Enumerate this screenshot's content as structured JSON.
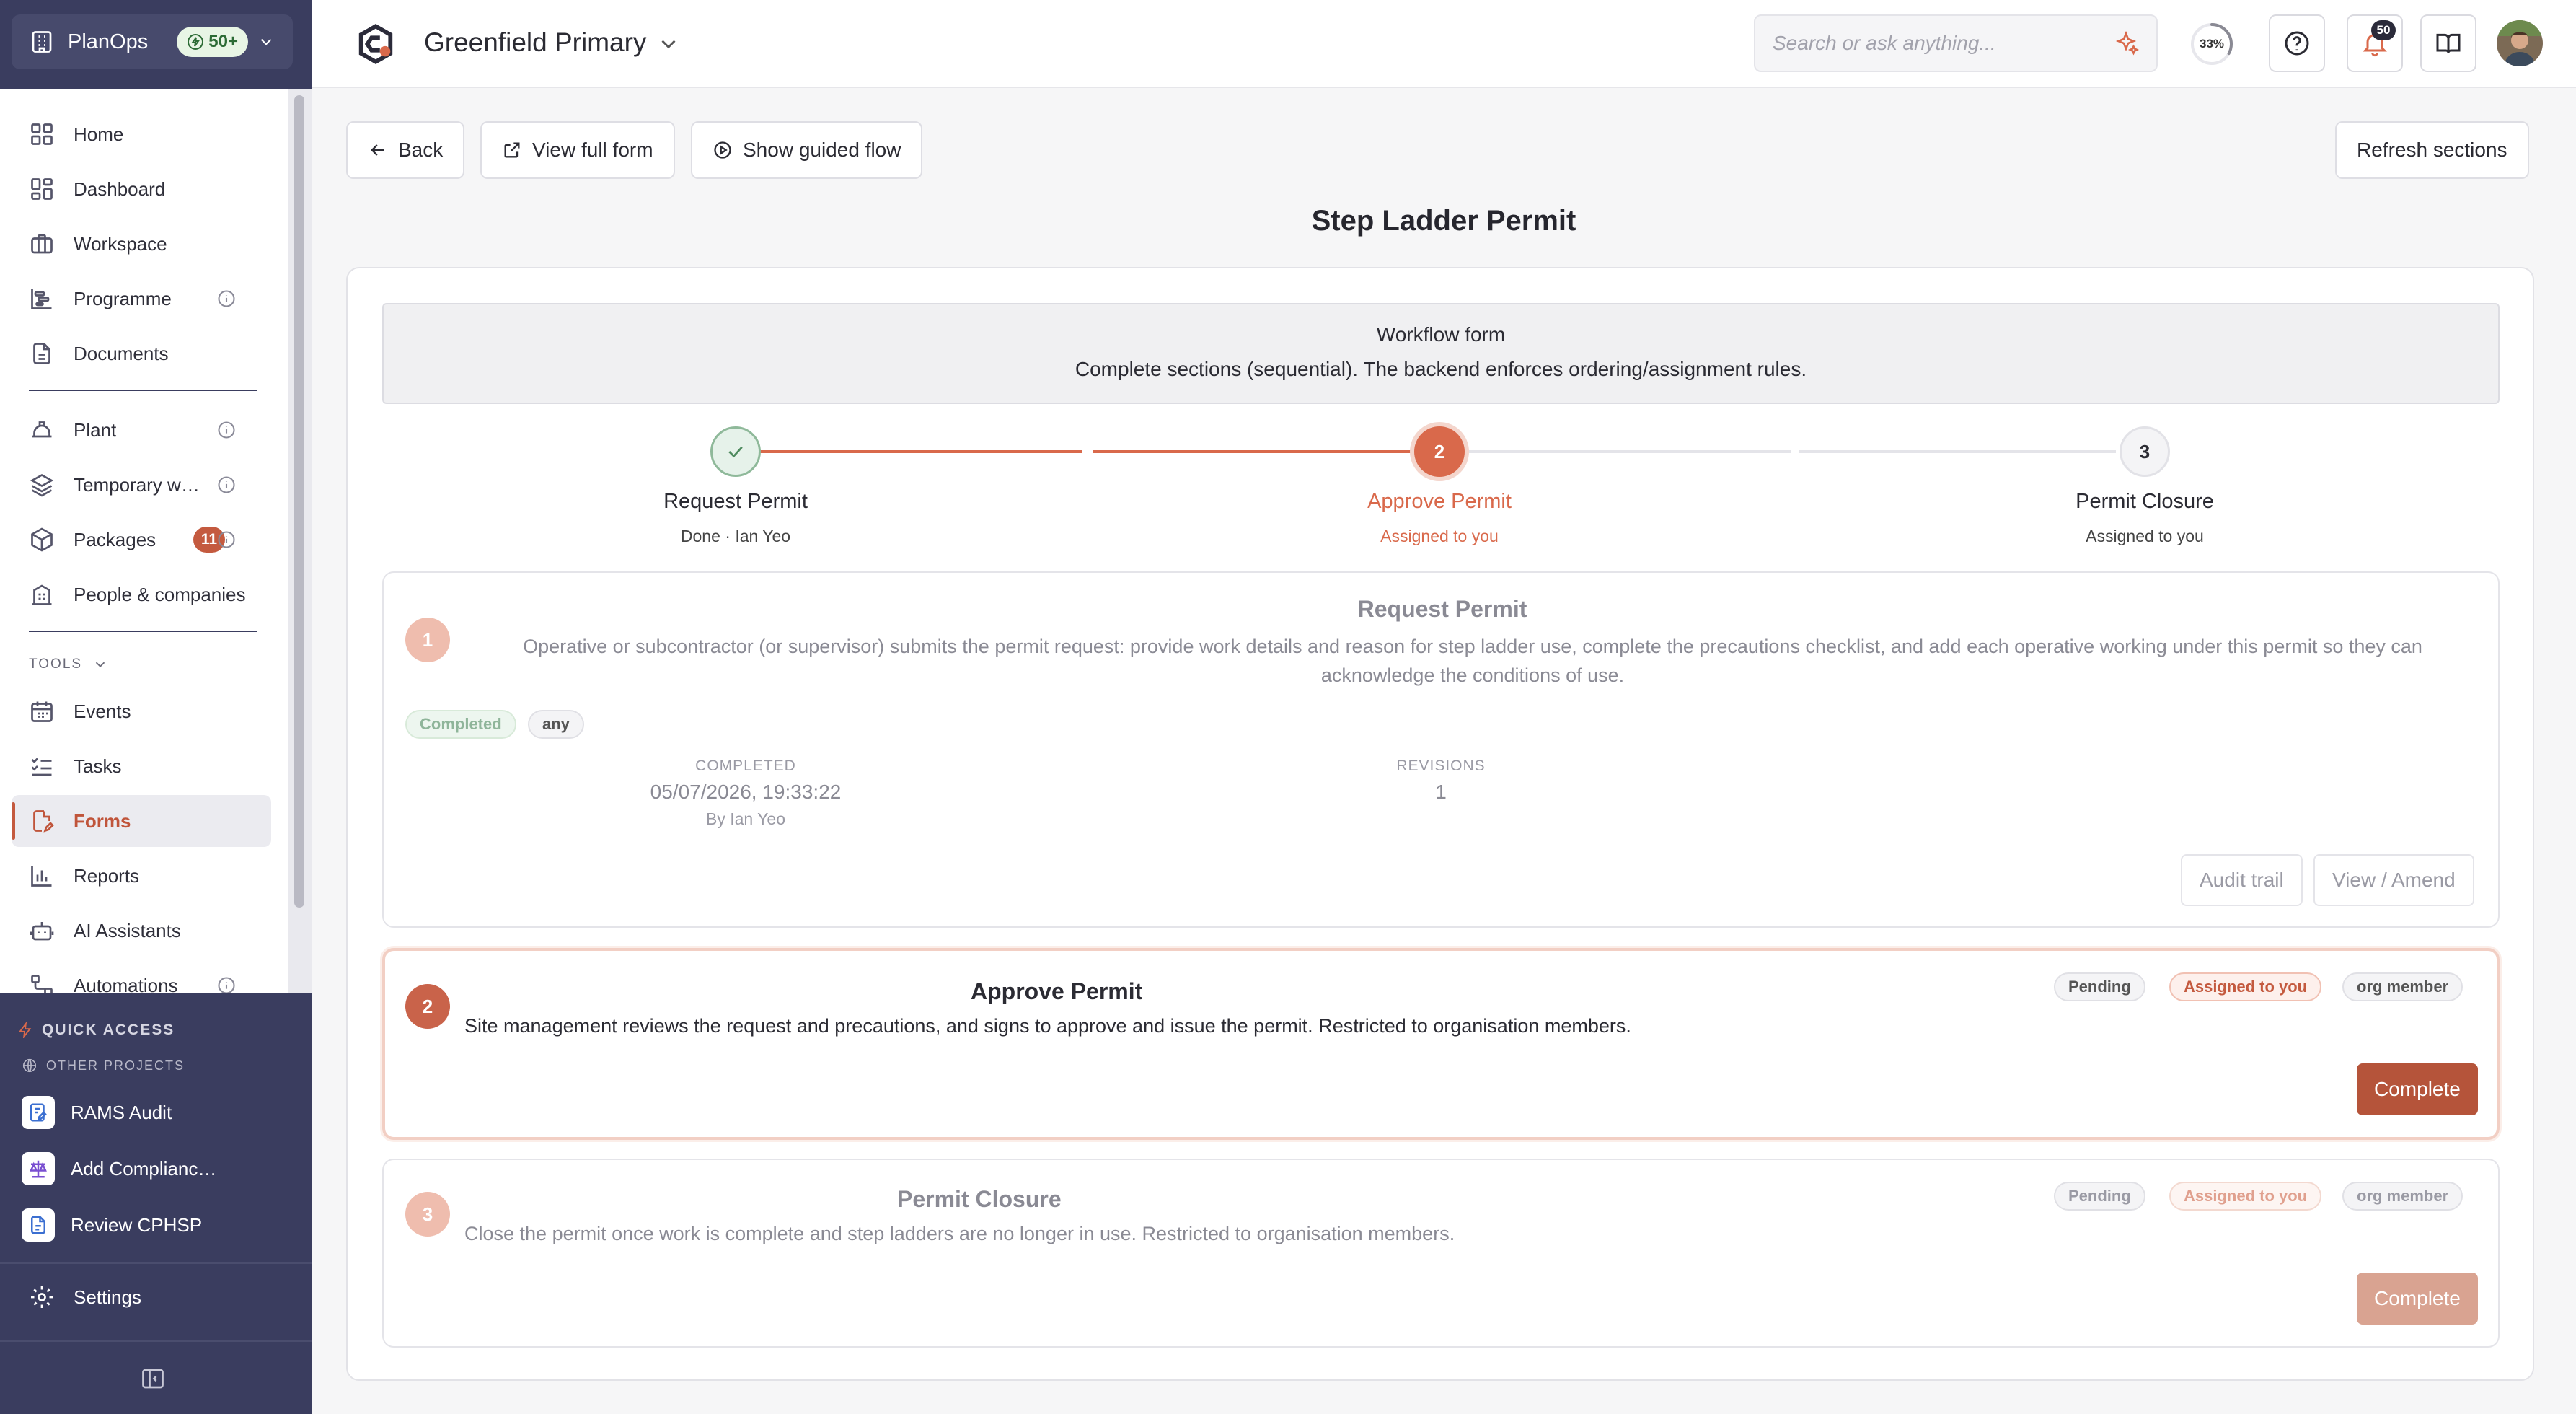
{
  "sidebar": {
    "app_name": "PlanOps",
    "credits": "50+",
    "nav": [
      {
        "label": "Home"
      },
      {
        "label": "Dashboard"
      },
      {
        "label": "Workspace"
      },
      {
        "label": "Programme"
      },
      {
        "label": "Documents"
      },
      {
        "label": "Plant"
      },
      {
        "label": "Temporary w…"
      },
      {
        "label": "Packages",
        "count": "11"
      },
      {
        "label": "People & companies"
      }
    ],
    "tools_label": "TOOLS",
    "tools": [
      {
        "label": "Events"
      },
      {
        "label": "Tasks"
      },
      {
        "label": "Forms"
      },
      {
        "label": "Reports"
      },
      {
        "label": "AI Assistants"
      },
      {
        "label": "Automations"
      }
    ],
    "quick_access_label": "QUICK ACCESS",
    "other_projects_label": "OTHER PROJECTS",
    "quick_items": [
      {
        "label": "RAMS Audit"
      },
      {
        "label": "Add Complianc…"
      },
      {
        "label": "Review CPHSP"
      }
    ],
    "settings_label": "Settings"
  },
  "topbar": {
    "project_name": "Greenfield Primary",
    "search_placeholder": "Search or ask anything...",
    "progress_label": "33%",
    "progress_value": 0.33,
    "notifications_count": "50"
  },
  "toolbar": {
    "back": "Back",
    "view_full_form": "View full form",
    "show_guided_flow": "Show guided flow",
    "refresh_sections": "Refresh sections"
  },
  "page_title": "Step Ladder Permit",
  "workflow": {
    "title": "Workflow form",
    "description": "Complete sections (sequential). The backend enforces ordering/assignment rules."
  },
  "steps": [
    {
      "number": "",
      "label": "Request Permit",
      "sub": "Done · Ian Yeo",
      "state": "done"
    },
    {
      "number": "2",
      "label": "Approve Permit",
      "sub": "Assigned to you",
      "state": "active"
    },
    {
      "number": "3",
      "label": "Permit Closure",
      "sub": "Assigned to you",
      "state": "pending"
    }
  ],
  "sections": [
    {
      "number": "1",
      "title": "Request Permit",
      "description": "Operative or subcontractor (or supervisor) submits the permit request: provide work details and reason for step ladder use, complete the precautions checklist, and add each operative working under this permit so they can acknowledge the conditions of use.",
      "chips": [
        "Completed",
        "any"
      ],
      "completed_label": "COMPLETED",
      "completed_value": "05/07/2026, 19:33:22",
      "completed_by": "By Ian Yeo",
      "revisions_label": "REVISIONS",
      "revisions_value": "1",
      "buttons": [
        "Audit trail",
        "View / Amend"
      ]
    },
    {
      "number": "2",
      "title": "Approve Permit",
      "description": "Site management reviews the request and precautions, and signs to approve and issue the permit. Restricted to organisation members.",
      "chips": [
        "Pending",
        "Assigned to you",
        "org member"
      ],
      "button": "Complete"
    },
    {
      "number": "3",
      "title": "Permit Closure",
      "description": "Close the permit once work is complete and step ladders are no longer in use. Restricted to organisation members.",
      "chips": [
        "Pending",
        "Assigned to you",
        "org member"
      ],
      "button": "Complete"
    }
  ],
  "colors": {
    "sidebar_bg": "#3a3d5f",
    "accent": "#c45a3f",
    "accent_dark": "#b5543a",
    "done_green": "#e6f2ea"
  }
}
